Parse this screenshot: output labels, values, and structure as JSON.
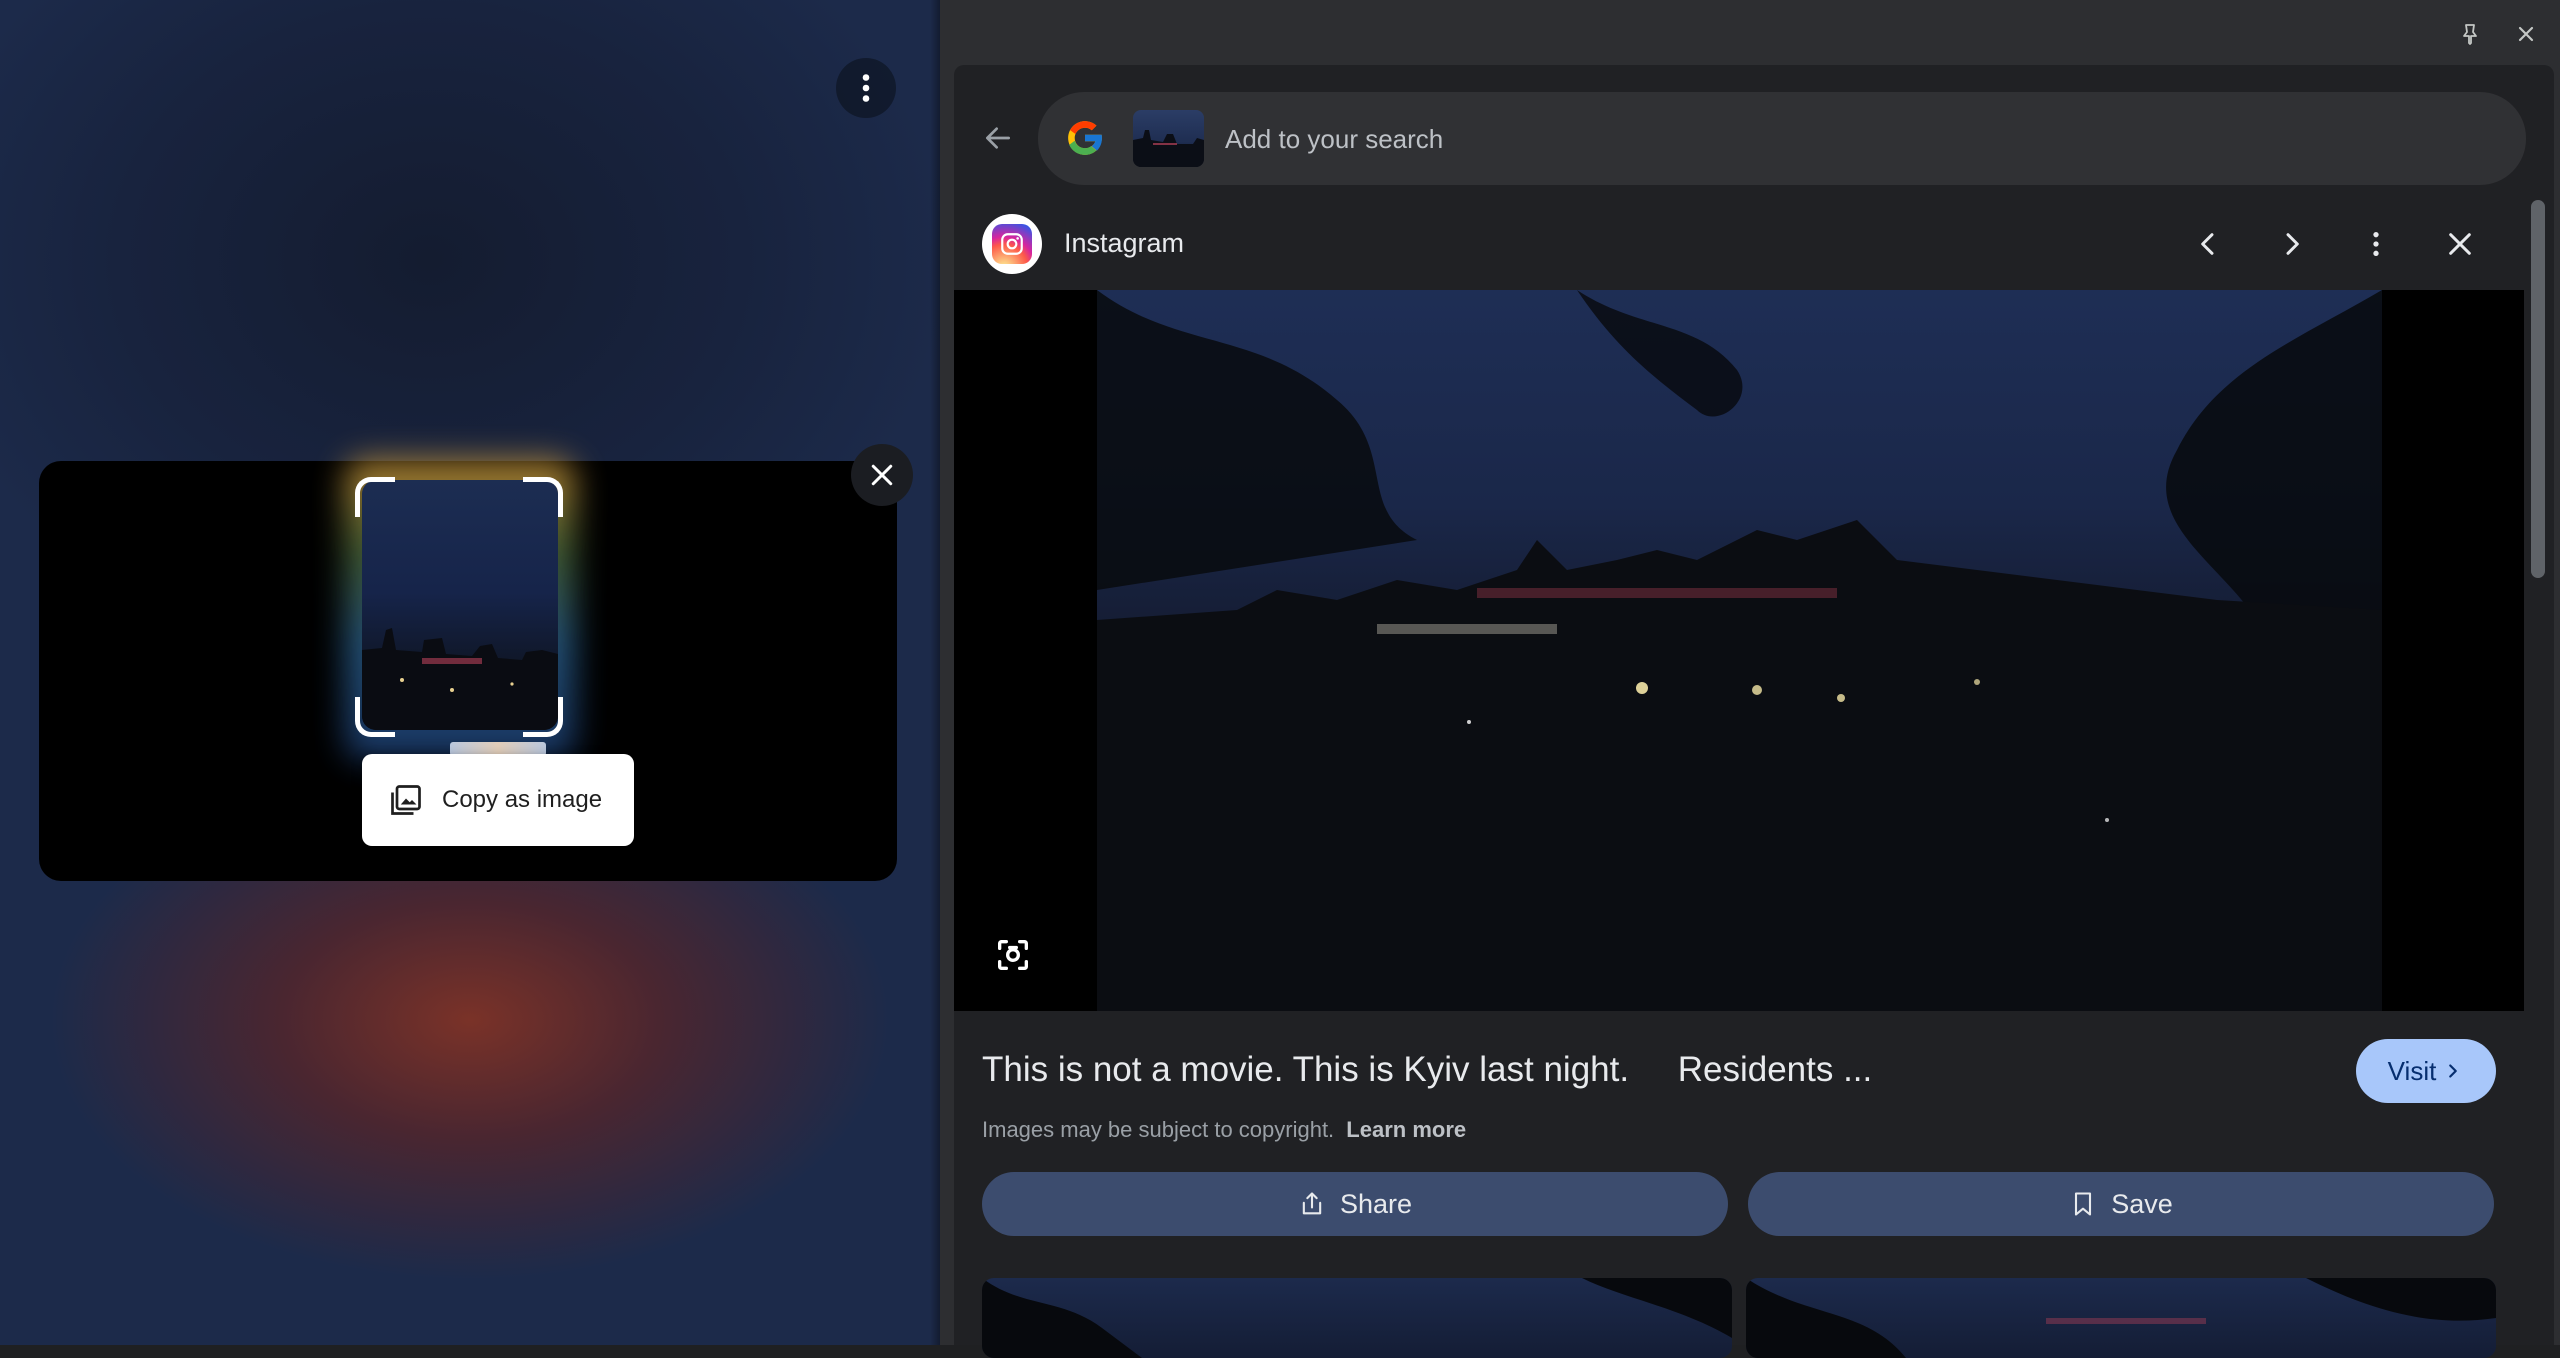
{
  "left_pane": {
    "menu_icon": "more-vert-icon",
    "close_icon": "close-icon",
    "copy_as_image_label": "Copy as image",
    "copy_icon": "image-copy-icon"
  },
  "side_panel": {
    "pin_icon": "pin-icon",
    "close_icon": "close-icon",
    "search_placeholder": "Add to your search",
    "result": {
      "source": "Instagram",
      "title": "This is not a movie. This is Kyiv last night.     Residents ...",
      "visit_label": "Visit",
      "copyright_text": "Images may be subject to copyright.",
      "learn_more_label": "Learn more",
      "share_label": "Share",
      "save_label": "Save"
    }
  }
}
